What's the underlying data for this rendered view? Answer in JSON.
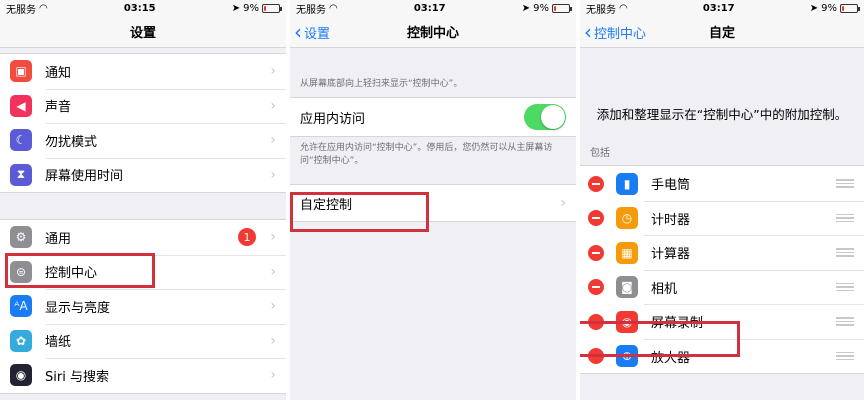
{
  "left_panel": {
    "status": {
      "carrier": "无服务",
      "time": "03:15",
      "battery": "9%",
      "battery_level": 0.09
    },
    "title": "设置",
    "group1": [
      {
        "label": "通知",
        "icon": "bell-icon",
        "color": "#f24b3f"
      },
      {
        "label": "声音",
        "icon": "speaker-icon",
        "color": "#f0325c"
      },
      {
        "label": "勿扰模式",
        "icon": "moon-icon",
        "color": "#5b5bd6"
      },
      {
        "label": "屏幕使用时间",
        "icon": "hourglass-icon",
        "color": "#5b5bd6"
      }
    ],
    "group2": [
      {
        "label": "通用",
        "icon": "gear-icon",
        "color": "#8e8e93",
        "badge": "1"
      },
      {
        "label": "控制中心",
        "icon": "switches-icon",
        "color": "#8e8e93"
      },
      {
        "label": "显示与亮度",
        "icon": "text-size-icon",
        "color": "#1a7cf5"
      },
      {
        "label": "墙纸",
        "icon": "flower-icon",
        "color": "#35aadc"
      },
      {
        "label": "Siri 与搜索",
        "icon": "siri-icon",
        "color": "#222233"
      }
    ]
  },
  "middle_panel": {
    "status": {
      "carrier": "无服务",
      "time": "03:17",
      "battery": "9%",
      "battery_level": 0.09
    },
    "back_label": "设置",
    "title": "控制中心",
    "top_hint": "从屏幕底部向上轻扫来显示“控制中心”。",
    "toggle_label": "应用内访问",
    "toggle_on": true,
    "toggle_hint": "允许在应用内访问“控制中心”。停用后，您仍然可以从主屏幕访问“控制中心”。",
    "customize_label": "自定控制"
  },
  "right_panel": {
    "status": {
      "carrier": "无服务",
      "time": "03:17",
      "battery": "9%",
      "battery_level": 0.09
    },
    "back_label": "控制中心",
    "title": "自定",
    "description": "添加和整理显示在“控制中心”中的附加控制。",
    "section_label": "包括",
    "items": [
      {
        "label": "手电筒",
        "icon": "flashlight-icon",
        "color": "#1a7cf5"
      },
      {
        "label": "计时器",
        "icon": "timer-icon",
        "color": "#f59a0a"
      },
      {
        "label": "计算器",
        "icon": "calculator-icon",
        "color": "#f59a0a"
      },
      {
        "label": "相机",
        "icon": "camera-icon",
        "color": "#8e8e93"
      },
      {
        "label": "屏幕录制",
        "icon": "record-icon",
        "color": "#f03a33"
      },
      {
        "label": "放大器",
        "icon": "magnifier-icon",
        "color": "#1a7cf5"
      }
    ]
  },
  "highlight_color": "#d1303d"
}
